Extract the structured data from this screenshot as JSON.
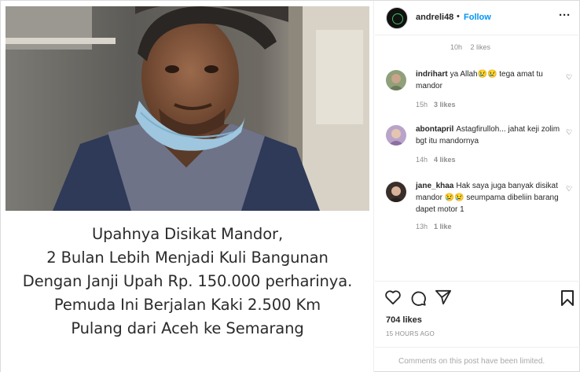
{
  "post": {
    "caption_lines": [
      "Upahnya Disikat Mandor,",
      "2 Bulan Lebih Menjadi Kuli Bangunan",
      "Dengan Janji Upah Rp. 150.000 perharinya.",
      "Pemuda Ini Berjalan Kaki 2.500 Km",
      "Pulang dari Aceh ke Semarang"
    ]
  },
  "header": {
    "username": "andreli48",
    "separator": "•",
    "follow_label": "Follow",
    "more_label": "···"
  },
  "top_meta": {
    "time": "10h",
    "likes": "2 likes"
  },
  "comments": [
    {
      "user": "indrihart",
      "text": "ya Allah😢😢 tega amat tu mandor",
      "time": "15h",
      "likes": "3 likes"
    },
    {
      "user": "abontapril",
      "text": "Astagfirulloh... jahat keji zolim bgt itu mandornya",
      "time": "14h",
      "likes": "4 likes"
    },
    {
      "user": "jane_khaa",
      "text": "Hak saya juga banyak disikat mandor 😢😢 seumpama dibeliin barang dapet motor 1",
      "time": "13h",
      "likes": "1 like"
    }
  ],
  "footer": {
    "likes_count": "704 likes",
    "time_ago": "15 HOURS AGO",
    "comments_limited": "Comments on this post have been limited."
  },
  "colors": {
    "link": "#0095f6",
    "muted": "#8e8e8e",
    "border": "#dbdbdb"
  },
  "icons": [
    "heart-icon",
    "comment-icon",
    "share-icon",
    "bookmark-icon",
    "more-options-icon"
  ]
}
